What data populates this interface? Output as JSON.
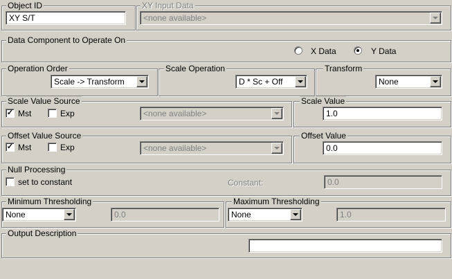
{
  "object_id": {
    "label": "Object ID",
    "value": "XY S/T"
  },
  "xy_input": {
    "label": "XY Input Data",
    "value": "<none available>"
  },
  "data_component": {
    "label": "Data Component to Operate On",
    "options": [
      {
        "label": "X Data",
        "selected": false
      },
      {
        "label": "Y Data",
        "selected": true
      }
    ]
  },
  "operation_order": {
    "label": "Operation Order",
    "value": "Scale -> Transform"
  },
  "scale_operation": {
    "label": "Scale Operation",
    "value": "D * Sc + Off"
  },
  "transform": {
    "label": "Transform",
    "value": "None"
  },
  "scale_value_source": {
    "label": "Scale Value Source",
    "mst": {
      "label": "Mst",
      "checked": true
    },
    "exp": {
      "label": "Exp",
      "checked": false
    },
    "value": "<none available>"
  },
  "scale_value": {
    "label": "Scale Value",
    "value": "1.0"
  },
  "offset_value_source": {
    "label": "Offset Value Source",
    "mst": {
      "label": "Mst",
      "checked": true
    },
    "exp": {
      "label": "Exp",
      "checked": false
    },
    "value": "<none available>"
  },
  "offset_value": {
    "label": "Offset Value",
    "value": "0.0"
  },
  "null_processing": {
    "label": "Null Processing",
    "set_to_constant": {
      "label": "set to constant",
      "checked": false
    },
    "constant_label": "Constant:",
    "constant_value": "0.0"
  },
  "min_threshold": {
    "label": "Minimum Thresholding",
    "mode": "None",
    "value": "0.0"
  },
  "max_threshold": {
    "label": "Maximum Thresholding",
    "mode": "None",
    "value": "1.0"
  },
  "output_description": {
    "label": "Output Description",
    "value": ""
  },
  "glyphs": {
    "check": "✓"
  }
}
